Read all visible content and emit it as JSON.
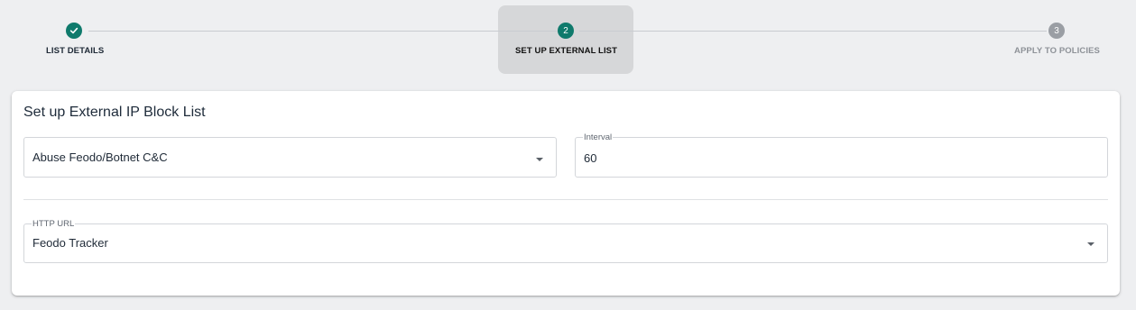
{
  "stepper": {
    "steps": [
      {
        "label": "LIST DETAILS",
        "number": "1",
        "state": "done"
      },
      {
        "label": "SET UP EXTERNAL LIST",
        "number": "2",
        "state": "active"
      },
      {
        "label": "APPLY TO POLICIES",
        "number": "3",
        "state": "pending"
      }
    ]
  },
  "card": {
    "title": "Set up External IP Block List",
    "source_select": {
      "value": "Abuse Feodo/Botnet C&C"
    },
    "interval_field": {
      "label": "Interval",
      "value": "60"
    },
    "http_url_select": {
      "label": "HTTP URL",
      "value": "Feodo Tracker"
    }
  },
  "colors": {
    "accent": "#0f7a6c",
    "pending": "#9a9ea4",
    "active_step_bg": "#d6d7d9",
    "page_bg": "#eeeff1"
  }
}
